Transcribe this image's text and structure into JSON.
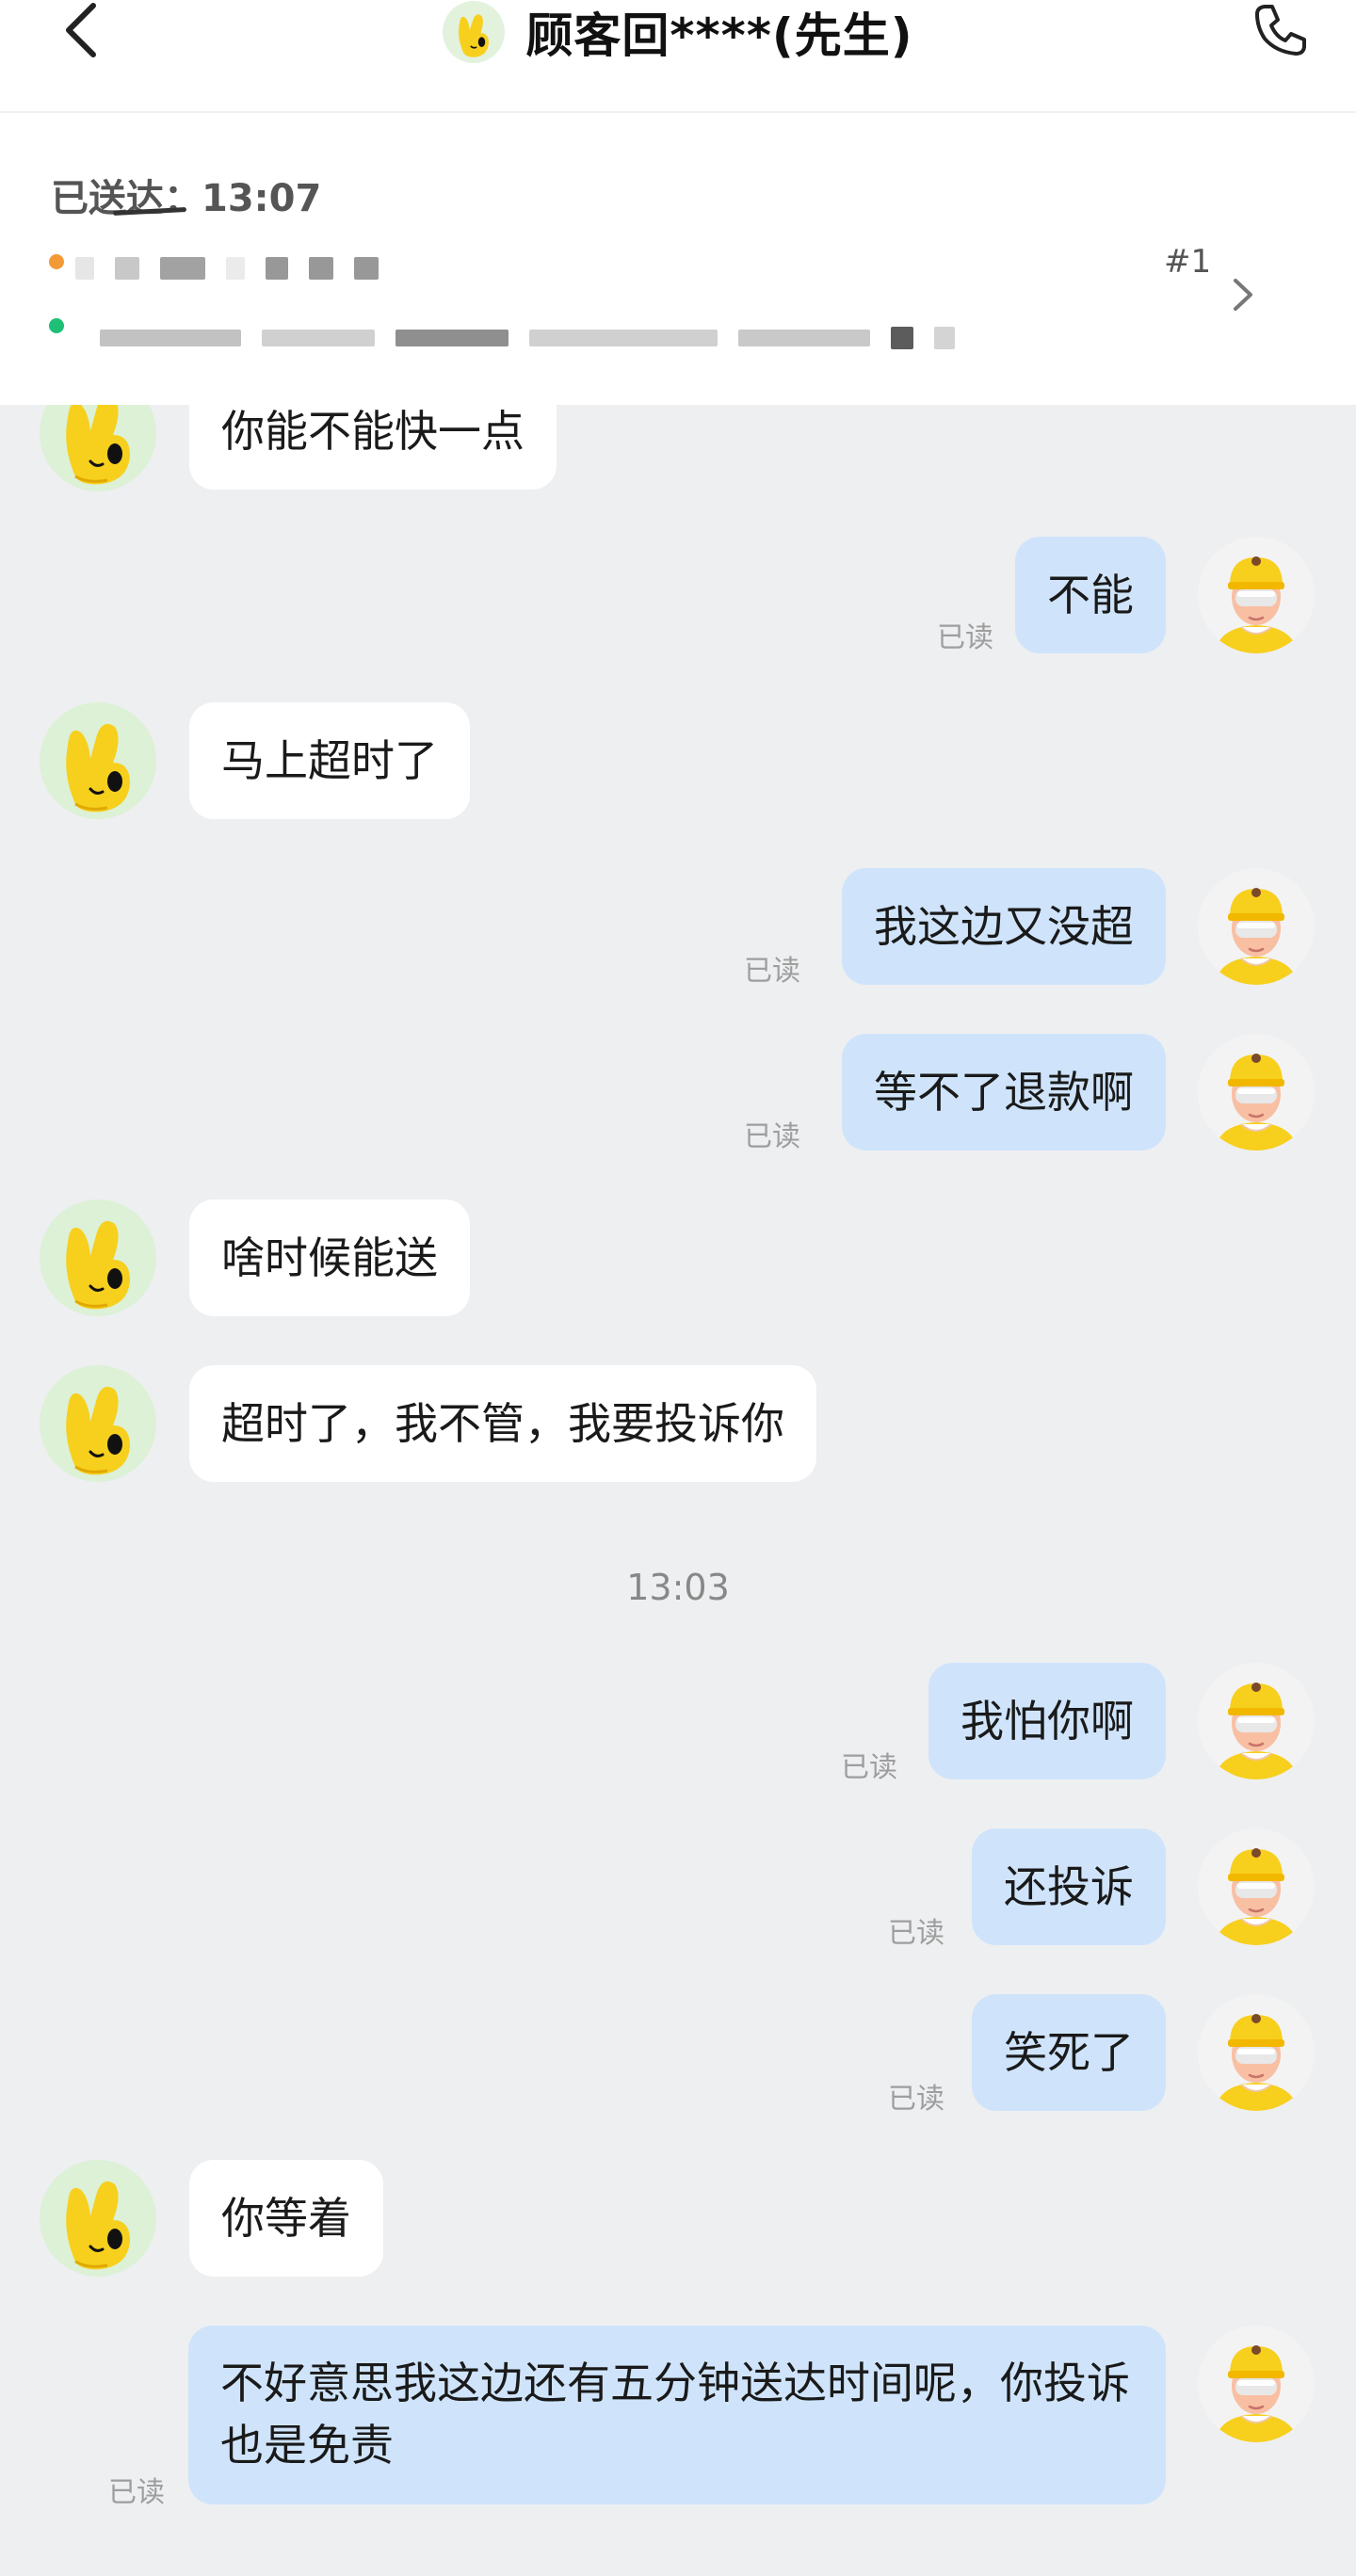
{
  "header": {
    "title": "顾客回****(先生)",
    "back_icon": "chevron-left-icon",
    "call_icon": "phone-icon"
  },
  "order": {
    "status_label": "已送达：",
    "status_time": "13:07",
    "order_number": "#1"
  },
  "messages": [
    {
      "from": "customer",
      "text": "你能不能快一点"
    },
    {
      "from": "rider",
      "text": "不能",
      "read": "已读"
    },
    {
      "from": "customer",
      "text": "马上超时了"
    },
    {
      "from": "rider",
      "text": "我这边又没超",
      "read": "已读"
    },
    {
      "from": "rider",
      "text": "等不了退款啊",
      "read": "已读"
    },
    {
      "from": "customer",
      "text": "啥时候能送"
    },
    {
      "from": "customer",
      "text": "超时了，我不管，我要投诉你"
    },
    {
      "from": "rider",
      "text": "我怕你啊",
      "read": "已读"
    },
    {
      "from": "rider",
      "text": "还投诉",
      "read": "已读"
    },
    {
      "from": "rider",
      "text": "笑死了",
      "read": "已读"
    },
    {
      "from": "customer",
      "text": "你等着"
    },
    {
      "from": "rider",
      "text": "不好意思我这边还有五分钟送达时间呢，你投诉也是免责",
      "read": "已读"
    }
  ],
  "time_separator": "13:03",
  "colors": {
    "background": "#eeeff1",
    "rider_bubble": "#cfe4fb",
    "customer_bubble": "#ffffff",
    "customer_avatar_bg": "#dcf1d6",
    "mascot_yellow": "#f7cf1d"
  }
}
